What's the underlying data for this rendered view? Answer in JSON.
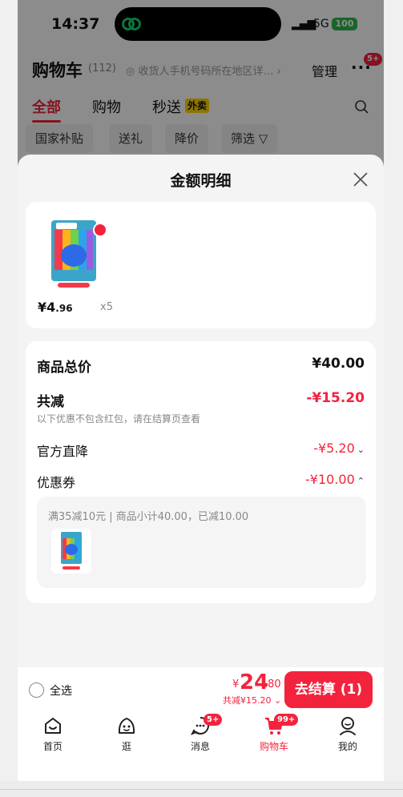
{
  "status_bar": {
    "time": "14:37",
    "network": "5G",
    "battery": "100"
  },
  "header": {
    "title": "购物车",
    "count": "(112)",
    "address": "收货人手机号码所在地区详…",
    "manage": "管理",
    "more": "···",
    "badge": "5+"
  },
  "tabs": [
    {
      "label": "全部"
    },
    {
      "label": "购物"
    },
    {
      "label": "秒送"
    }
  ],
  "waimai_tag": "外卖",
  "chips": [
    {
      "label": "国家补贴"
    },
    {
      "label": "送礼"
    },
    {
      "label": "降价"
    },
    {
      "label": "筛选 ▽"
    }
  ],
  "sheet": {
    "title": "金额明细",
    "product": {
      "price_symbol": "¥",
      "price_int": "4",
      "price_dec": ".96",
      "qty": "x5"
    },
    "rows": {
      "total_label": "商品总价",
      "total_value": "¥40.00",
      "discount_label": "共减",
      "discount_value": "-¥15.20",
      "note": "以下优惠不包含红包，请在结算页查看",
      "official_label": "官方直降",
      "official_value": "-¥5.20",
      "coupon_label": "优惠券",
      "coupon_value": "-¥10.00"
    },
    "coupon_detail": "满35减10元 | 商品小计40.00，已减10.00"
  },
  "bottom": {
    "select_all": "全选",
    "total_symbol": "¥",
    "total_int": "24",
    "total_dec": ".80",
    "saved": "共减¥15.20",
    "checkout": "去结算 (1)"
  },
  "nav": [
    {
      "label": "首页"
    },
    {
      "label": "逛"
    },
    {
      "label": "消息",
      "badge": "5+"
    },
    {
      "label": "购物车",
      "badge": "99+"
    },
    {
      "label": "我的"
    }
  ],
  "colors": {
    "accent": "#f3233d",
    "battery": "#2db84d",
    "tag": "#ffd600"
  }
}
